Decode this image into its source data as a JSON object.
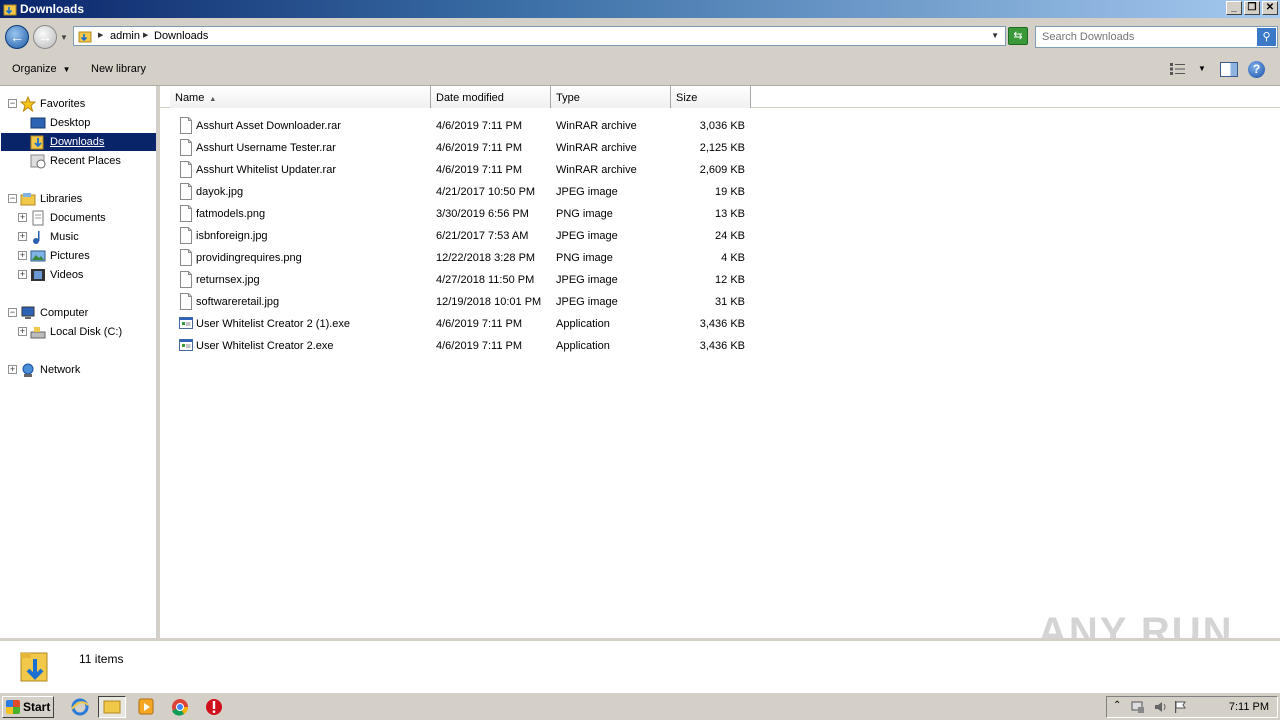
{
  "window": {
    "title": "Downloads",
    "minimize": "_",
    "restore": "❐",
    "close": "✕"
  },
  "address": {
    "crumbs": [
      "admin",
      "Downloads"
    ],
    "search_placeholder": "Search Downloads"
  },
  "toolbar": {
    "organize": "Organize",
    "new_library": "New library"
  },
  "nav": {
    "favorites": "Favorites",
    "desktop": "Desktop",
    "downloads": "Downloads",
    "recent_places": "Recent Places",
    "libraries": "Libraries",
    "documents": "Documents",
    "music": "Music",
    "pictures": "Pictures",
    "videos": "Videos",
    "computer": "Computer",
    "local_disk": "Local Disk (C:)",
    "network": "Network"
  },
  "columns": {
    "name": "Name",
    "date": "Date modified",
    "type": "Type",
    "size": "Size"
  },
  "files": [
    {
      "name": "Asshurt Asset Downloader.rar",
      "date": "4/6/2019 7:11 PM",
      "type": "WinRAR archive",
      "size": "3,036 KB",
      "kind": "file"
    },
    {
      "name": "Asshurt Username Tester.rar",
      "date": "4/6/2019 7:11 PM",
      "type": "WinRAR archive",
      "size": "2,125 KB",
      "kind": "file"
    },
    {
      "name": "Asshurt Whitelist Updater.rar",
      "date": "4/6/2019 7:11 PM",
      "type": "WinRAR archive",
      "size": "2,609 KB",
      "kind": "file"
    },
    {
      "name": "dayok.jpg",
      "date": "4/21/2017 10:50 PM",
      "type": "JPEG image",
      "size": "19 KB",
      "kind": "file"
    },
    {
      "name": "fatmodels.png",
      "date": "3/30/2019 6:56 PM",
      "type": "PNG image",
      "size": "13 KB",
      "kind": "file"
    },
    {
      "name": "isbnforeign.jpg",
      "date": "6/21/2017 7:53 AM",
      "type": "JPEG image",
      "size": "24 KB",
      "kind": "file"
    },
    {
      "name": "providingrequires.png",
      "date": "12/22/2018 3:28 PM",
      "type": "PNG image",
      "size": "4 KB",
      "kind": "file"
    },
    {
      "name": "returnsex.jpg",
      "date": "4/27/2018 11:50 PM",
      "type": "JPEG image",
      "size": "12 KB",
      "kind": "file"
    },
    {
      "name": "softwareretail.jpg",
      "date": "12/19/2018 10:01 PM",
      "type": "JPEG image",
      "size": "31 KB",
      "kind": "file"
    },
    {
      "name": "User Whitelist Creator 2 (1).exe",
      "date": "4/6/2019 7:11 PM",
      "type": "Application",
      "size": "3,436 KB",
      "kind": "exe"
    },
    {
      "name": "User Whitelist Creator 2.exe",
      "date": "4/6/2019 7:11 PM",
      "type": "Application",
      "size": "3,436 KB",
      "kind": "exe"
    }
  ],
  "status": {
    "item_count": "11 items"
  },
  "watermark": "ANY RUN",
  "taskbar": {
    "start": "Start",
    "clock": "7:11 PM"
  }
}
